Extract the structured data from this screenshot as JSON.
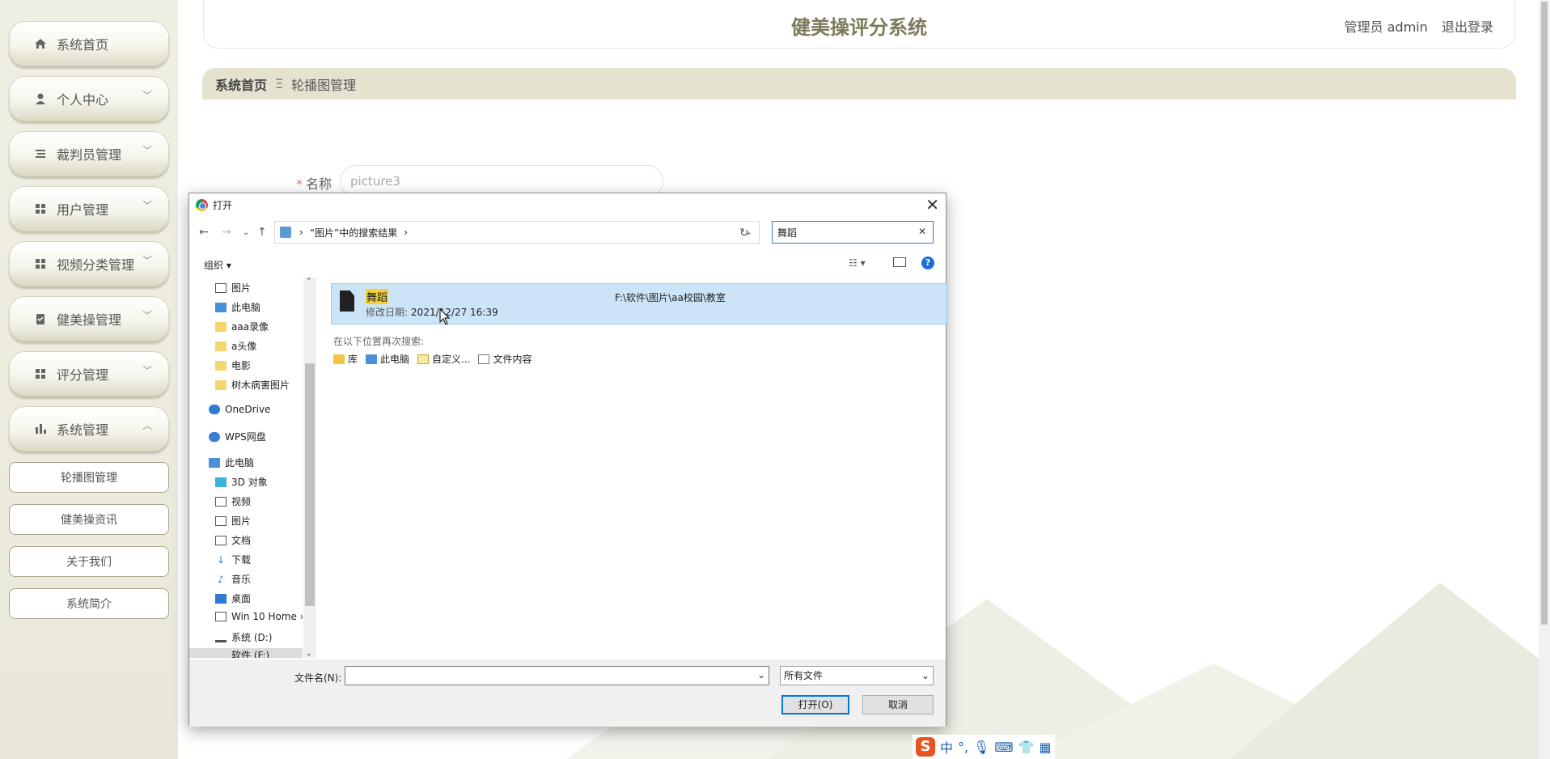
{
  "sidebar": {
    "items": [
      {
        "label": "系统首页",
        "icon": "home-icon"
      },
      {
        "label": "个人中心",
        "icon": "user-icon"
      },
      {
        "label": "裁判员管理",
        "icon": "list-icon"
      },
      {
        "label": "用户管理",
        "icon": "grid-icon"
      },
      {
        "label": "视频分类管理",
        "icon": "grid-icon"
      },
      {
        "label": "健美操管理",
        "icon": "clipboard-icon"
      },
      {
        "label": "评分管理",
        "icon": "grid-icon"
      },
      {
        "label": "系统管理",
        "icon": "bar-chart-icon"
      }
    ],
    "sub_items": [
      "轮播图管理",
      "健美操资讯",
      "关于我们",
      "系统简介"
    ]
  },
  "header": {
    "title": "健美操评分系统",
    "role": "管理员 admin",
    "logout": "退出登录"
  },
  "breadcrumb": {
    "home": "系统首页",
    "separator": "Ξ",
    "current": "轮播图管理"
  },
  "form": {
    "label": "名称",
    "required_mark": "*",
    "name_placeholder": "picture3"
  },
  "dialog": {
    "title": "打开",
    "address": "“图片”中的搜索结果",
    "search_value": "舞蹈",
    "organize": "组织 ▾",
    "tree": [
      "图片",
      "此电脑",
      "aaa录像",
      "a头像",
      "电影",
      "树木病害图片",
      "OneDrive",
      "WPS网盘",
      "此电脑",
      "3D 对象",
      "视频",
      "图片",
      "文档",
      "下载",
      "音乐",
      "桌面",
      "Win 10 Home ›",
      "系统 (D:)",
      "软件 (F:)"
    ],
    "result": {
      "name": "舞蹈",
      "date_label": "修改日期:",
      "date": "2021/12/27 16:39",
      "path": "F:\\软件\\图片\\aa校园\\教室"
    },
    "search_again_label": "在以下位置再次搜索:",
    "search_again_links": [
      "库",
      "此电脑",
      "自定义...",
      "文件内容"
    ],
    "filename_label": "文件名(N):",
    "filename_value": "",
    "filetype": "所有文件",
    "open_button": "打开(O)",
    "cancel_button": "取消"
  },
  "ime": {
    "labels": [
      "中",
      "°,"
    ]
  },
  "colors": {
    "accent": "#7d7a5b",
    "sidebar_bg": "#efeee2",
    "selection": "#cce4f7",
    "highlight": "#f3d233"
  }
}
